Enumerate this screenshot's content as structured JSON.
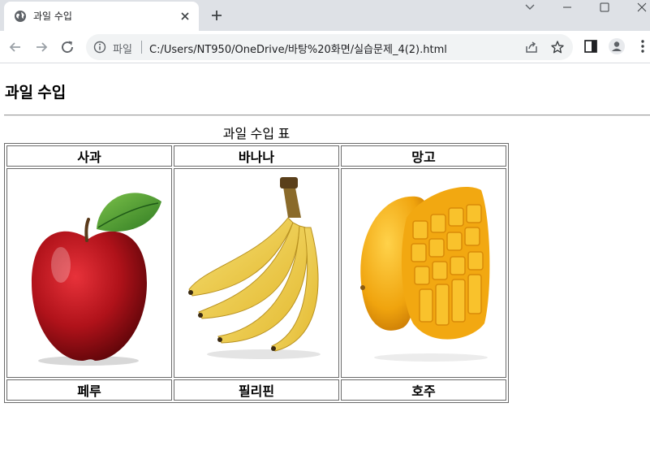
{
  "browser": {
    "tab_title": "과일 수입",
    "scheme_label": "파일",
    "url": "C:/Users/NT950/OneDrive/바탕%20화면/실습문제_4(2).html"
  },
  "page": {
    "title": "과일 수입",
    "table": {
      "caption": "과일 수입 표",
      "headers": [
        "사과",
        "바나나",
        "망고"
      ],
      "images": [
        "apple-image",
        "banana-image",
        "mango-image"
      ],
      "origins": [
        "페루",
        "필리핀",
        "호주"
      ]
    }
  }
}
